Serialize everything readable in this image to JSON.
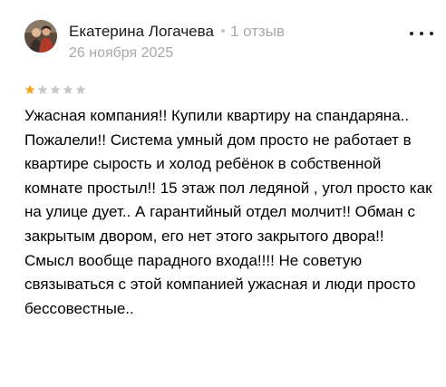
{
  "review": {
    "author_name": "Екатерина Логачева",
    "review_count": "1 отзыв",
    "date": "26 ноября 2025",
    "rating": 1,
    "rating_max": 5,
    "text": "Ужасная компания!! Купили квартиру на спандаряна.. Пожалели!! Система умный дом просто не работает в квартире сырость и холод ребёнок в собственной комнате простыл!! 15 этаж пол ледяной , угол просто как на улице дует.. А гарантийный отдел молчит!! Обман с закрытым двором, его нет этого закрытого двора!! Смысл вообще парадного входа!!!! Не советую связываться с этой компанией ужасная и люди просто бессовестные..",
    "avatar_icon": "user-photo-avatar",
    "more_icon": "more-dots-icon",
    "colors": {
      "star_filled": "#f5a623",
      "star_empty": "#c8c8c8",
      "secondary_text": "#a8a8a8"
    }
  }
}
